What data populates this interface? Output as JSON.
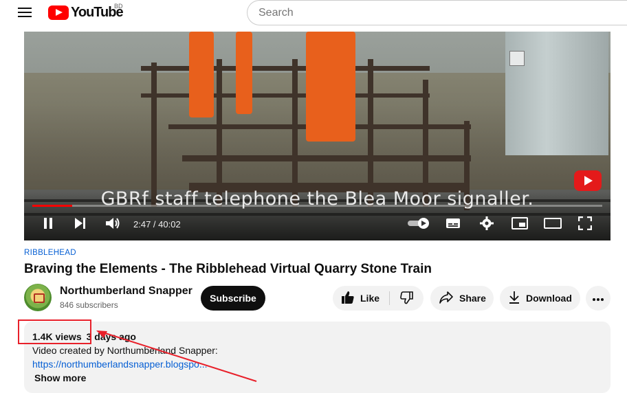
{
  "header": {
    "logo_text": "YouTube",
    "country_code": "BD",
    "search_placeholder": "Search"
  },
  "player": {
    "caption": "GBRf staff telephone the Blea Moor signaller.",
    "current_time": "2:47",
    "duration": "40:02",
    "progress_fraction": 0.07
  },
  "video": {
    "channel_tag": "RIBBLEHEAD",
    "title": "Braving the Elements - The Ribblehead Virtual Quarry Stone Train"
  },
  "channel": {
    "name": "Northumberland Snapper",
    "subscribers": "846 subscribers",
    "subscribe_label": "Subscribe"
  },
  "actions": {
    "like_label": "Like",
    "share_label": "Share",
    "download_label": "Download"
  },
  "description": {
    "views": "1.4K views",
    "age": "3 days ago",
    "line1": "Video created by Northumberland Snapper:",
    "link": "https://northumberlandsnapper.blogspo...",
    "show_more": "Show more"
  },
  "annotation": {
    "color": "#e8202a"
  }
}
